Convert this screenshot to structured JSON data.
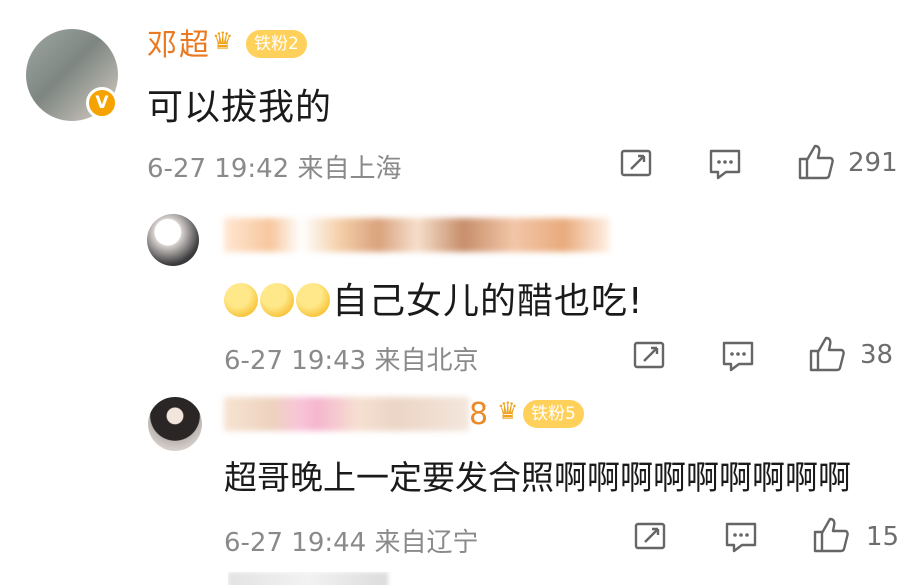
{
  "comments": [
    {
      "username": "邓超",
      "fan_badge": "铁粉2",
      "verified_icon": "v-badge-icon",
      "text": "可以拔我的",
      "meta": "6-27 19:42 来自上海",
      "likes": "291"
    },
    {
      "username_blurred": true,
      "text": "自己女儿的醋也吃!",
      "emoji_icon": "grimace-emoji-icon",
      "meta": "6-27 19:43 来自北京",
      "likes": "38"
    },
    {
      "username_suffix": "8",
      "fan_badge": "铁粉5",
      "text": "超哥晚上一定要发合照啊啊啊啊啊啊啊啊啊",
      "meta": "6-27 19:44 来自辽宁",
      "likes": "15"
    }
  ],
  "icons": {
    "share": "share-icon",
    "comment": "comment-icon",
    "like": "thumbs-up-icon"
  },
  "colors": {
    "username": "#ea7a22",
    "fan_badge": "#ffd05a",
    "meta_text": "#8a8a8a"
  }
}
